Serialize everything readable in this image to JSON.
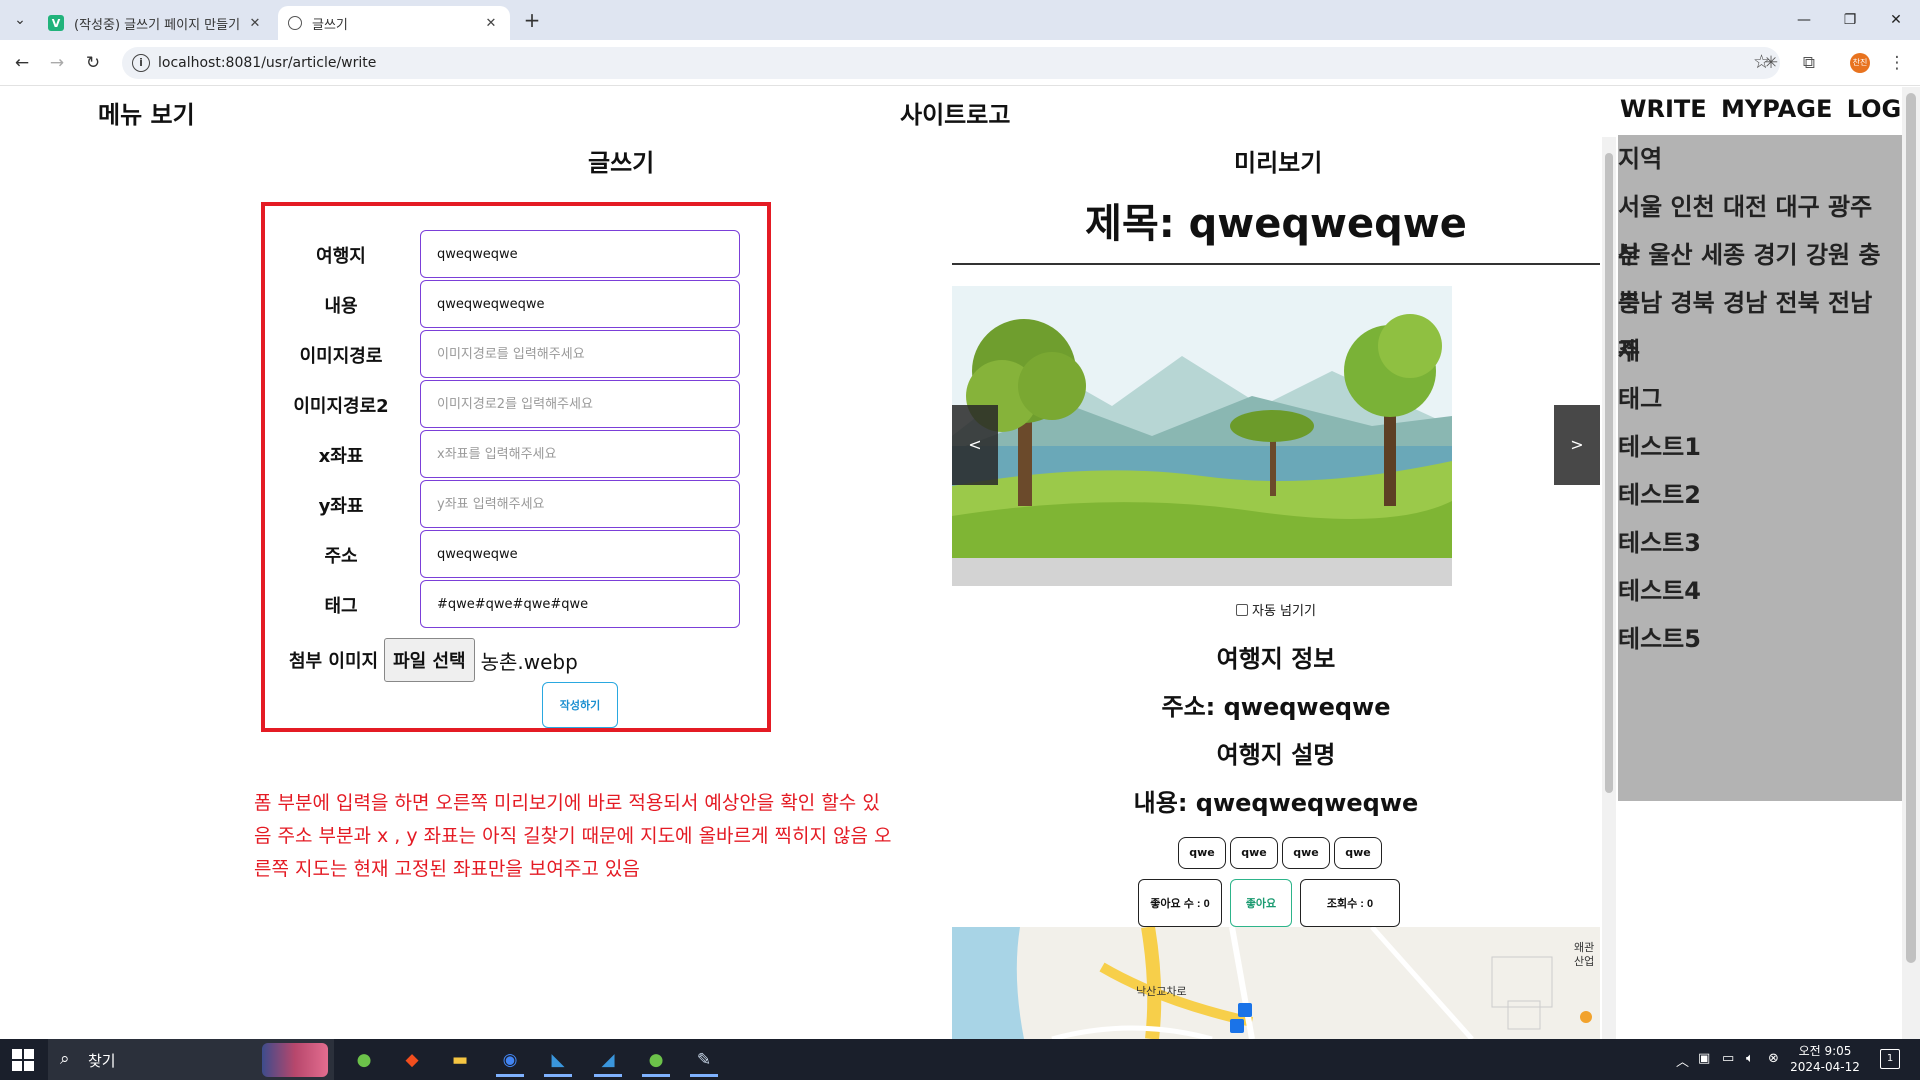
{
  "browser": {
    "tabs": [
      {
        "title": "(작성중) 글쓰기 페이지 만들기",
        "icon": "vue-icon",
        "active": false
      },
      {
        "title": "글쓰기",
        "icon": "globe-icon",
        "active": true
      }
    ],
    "url": "localhost:8081/usr/article/write",
    "profile_initials": "찬진"
  },
  "header": {
    "menu_label": "메뉴 보기",
    "logo": "사이트로고",
    "links": [
      "WRITE",
      "MYPAGE",
      "LOGOUT"
    ]
  },
  "form": {
    "heading": "글쓰기",
    "fields": [
      {
        "label": "여행지",
        "value": "qweqweqwe",
        "placeholder": ""
      },
      {
        "label": "내용",
        "value": "qweqweqweqwe",
        "placeholder": ""
      },
      {
        "label": "이미지경로",
        "value": "",
        "placeholder": "이미지경로를 입력해주세요"
      },
      {
        "label": "이미지경로2",
        "value": "",
        "placeholder": "이미지경로2를 입력해주세요"
      },
      {
        "label": "x좌표",
        "value": "",
        "placeholder": "x좌표를 입력해주세요"
      },
      {
        "label": "y좌표",
        "value": "",
        "placeholder": "y좌표 입력해주세요"
      },
      {
        "label": "주소",
        "value": "qweqweqwe",
        "placeholder": ""
      },
      {
        "label": "태그",
        "value": "#qwe#qwe#qwe#qwe",
        "placeholder": ""
      }
    ],
    "file_label": "첨부 이미지",
    "file_button": "파일 선택",
    "file_name": "농촌.webp",
    "submit_label": "작성하기"
  },
  "note": "폼 부분에 입력을 하면 오른쪽 미리보기에 바로 적용되서 예상안을 확인 할수 있음 주소 부분과 x , y 좌표는 아직 길찾기 때문에 지도에 올바르게 찍히지 않음 오른쪽 지도는 현재 고정된 좌표만을 보여주고 있음",
  "preview": {
    "heading": "미리보기",
    "title": "제목: qweqweqwe",
    "prev_label": "<",
    "next_label": ">",
    "auto_slide_label": "자동 넘기기",
    "info_heading": "여행지 정보",
    "address_line": "주소: qweqweqwe",
    "desc_heading": "여행지 설명",
    "content_line": "내용: qweqweqweqwe",
    "tags": [
      "qwe",
      "qwe",
      "qwe",
      "qwe"
    ],
    "like_count_label": "좋아요 수 : 0",
    "like_button": "좋아요",
    "view_count_label": "조회수 : 0",
    "map_labels": [
      "낙산교차로",
      "왜관",
      "산업"
    ]
  },
  "sidebar": {
    "lines": [
      "지역",
      "서울 인천 대전 대구 광주 부",
      "산 울산 세종 경기 강원 충북",
      "충남 경북 경남 전북 전남 제",
      "주",
      "태그",
      "테스트1",
      "테스트2",
      "테스트3",
      "테스트4",
      "테스트5"
    ]
  },
  "taskbar": {
    "search_label": "찾기",
    "time": "오전 9:05",
    "date": "2024-04-12",
    "notification_count": "1"
  },
  "colors": {
    "form_border": "#e41b24",
    "input_border": "#7b3fd8",
    "note_text": "#e41b24",
    "sidebar_bg": "#b3b3b3"
  }
}
